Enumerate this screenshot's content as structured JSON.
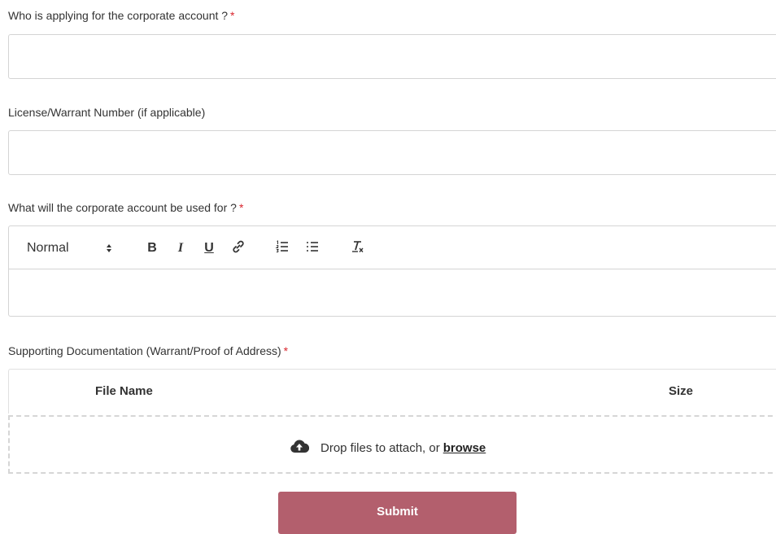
{
  "form": {
    "applicant": {
      "label": "Who is applying for the corporate account ?",
      "required_mark": "*",
      "value": "",
      "placeholder": ""
    },
    "license": {
      "label": "License/Warrant Number (if applicable)",
      "value": "",
      "placeholder": ""
    },
    "usage": {
      "label": "What will the corporate account be used for ?",
      "required_mark": "*",
      "toolbar": {
        "format_selected": "Normal",
        "format_arrows": "⬍",
        "bold": "B",
        "italic": "I",
        "underline": "U",
        "link_icon": "link-icon",
        "ordered_list_icon": "ordered-list-icon",
        "bullet_list_icon": "bullet-list-icon",
        "clean_icon": "clear-format-icon"
      }
    },
    "documents": {
      "label": "Supporting Documentation (Warrant/Proof of Address)",
      "required_mark": "*",
      "columns": [
        "File Name",
        "Size"
      ],
      "drop_text": "Drop files to attach, or",
      "browse_label": "browse",
      "upload_icon": "cloud-upload-icon"
    },
    "submit_label": "Submit"
  },
  "colors": {
    "required": "#d9262e",
    "submit_bg": "#b35f6d",
    "border": "#d4d4d4"
  }
}
